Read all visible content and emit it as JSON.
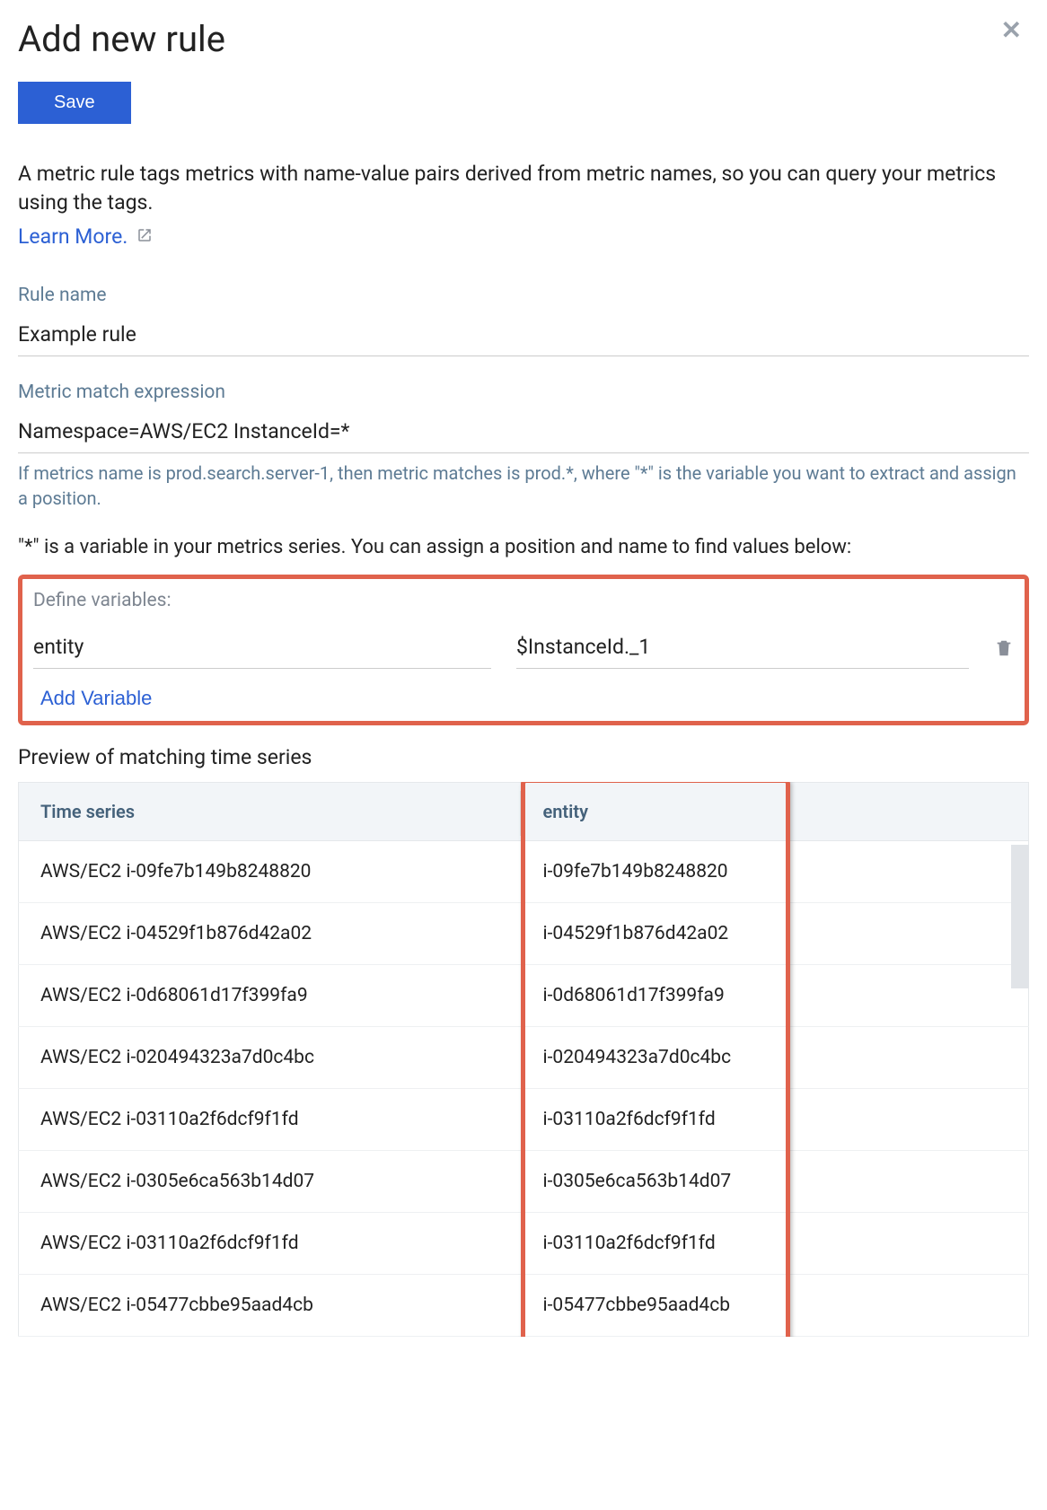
{
  "page_title": "Add new rule",
  "save_label": "Save",
  "description": "A metric rule tags metrics with name-value pairs derived from metric names, so you can query your metrics using the tags.",
  "learn_more_label": "Learn More.",
  "rule_name": {
    "label": "Rule name",
    "value": "Example rule"
  },
  "metric_expr": {
    "label": "Metric match expression",
    "value": "Namespace=AWS/EC2 InstanceId=*",
    "helper": "If metrics name is prod.search.server-1, then metric matches is prod.*, where \"*\" is the variable you want to extract and assign a position."
  },
  "variable_hint": "\"*\" is a variable in your metrics series. You can assign a position and name to find values below:",
  "define_variables_label": "Define variables:",
  "variables": [
    {
      "name": "entity",
      "pattern": "$InstanceId._1"
    }
  ],
  "add_variable_label": "Add Variable",
  "preview_title": "Preview of matching time series",
  "preview_headers": {
    "time_series": "Time series",
    "entity": "entity"
  },
  "preview_rows": [
    {
      "ts": "AWS/EC2 i-09fe7b149b8248820",
      "entity": "i-09fe7b149b8248820"
    },
    {
      "ts": "AWS/EC2 i-04529f1b876d42a02",
      "entity": "i-04529f1b876d42a02"
    },
    {
      "ts": "AWS/EC2 i-0d68061d17f399fa9",
      "entity": "i-0d68061d17f399fa9"
    },
    {
      "ts": "AWS/EC2 i-020494323a7d0c4bc",
      "entity": "i-020494323a7d0c4bc"
    },
    {
      "ts": "AWS/EC2 i-03110a2f6dcf9f1fd",
      "entity": "i-03110a2f6dcf9f1fd"
    },
    {
      "ts": "AWS/EC2 i-0305e6ca563b14d07",
      "entity": "i-0305e6ca563b14d07"
    },
    {
      "ts": "AWS/EC2 i-03110a2f6dcf9f1fd",
      "entity": "i-03110a2f6dcf9f1fd"
    },
    {
      "ts": "AWS/EC2 i-05477cbbe95aad4cb",
      "entity": "i-05477cbbe95aad4cb"
    }
  ]
}
